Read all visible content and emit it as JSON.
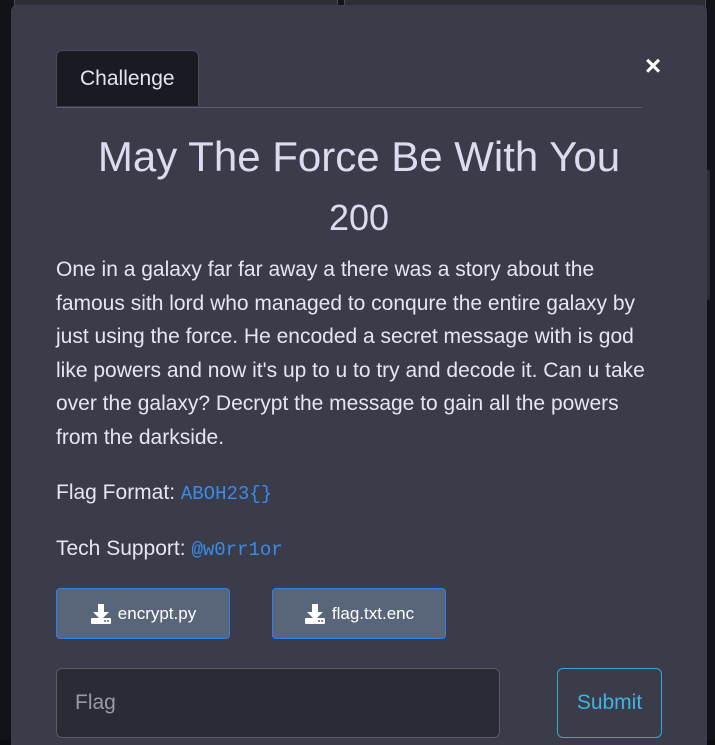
{
  "modal": {
    "tab_label": "Challenge",
    "close_glyph": "×",
    "title": "May The Force Be With You",
    "points": "200",
    "description": "One in a galaxy far far away a there was a story about the famous sith lord who managed to conqure the entire galaxy by just using the force. He encoded a secret message with is god like powers and now it's up to u to try and decode it. Can u take over the galaxy? Decrypt the message to gain all the powers from the darkside.",
    "flag_format_label": "Flag Format:",
    "flag_format_value": "ABOH23{}",
    "tech_support_label": "Tech Support:",
    "tech_support_value": "@w0rr1or",
    "files": [
      {
        "label": "encrypt.py",
        "icon": "download-icon"
      },
      {
        "label": "flag.txt.enc",
        "icon": "download-icon"
      }
    ],
    "flag_input": {
      "placeholder": "Flag",
      "value": ""
    },
    "submit_label": "Submit"
  },
  "colors": {
    "modal_bg": "#3b3c4a",
    "accent_link": "#3b8be8",
    "file_button_bg": "#596579",
    "file_button_border": "#2f7ff0",
    "submit_border": "#2ea9d6"
  }
}
